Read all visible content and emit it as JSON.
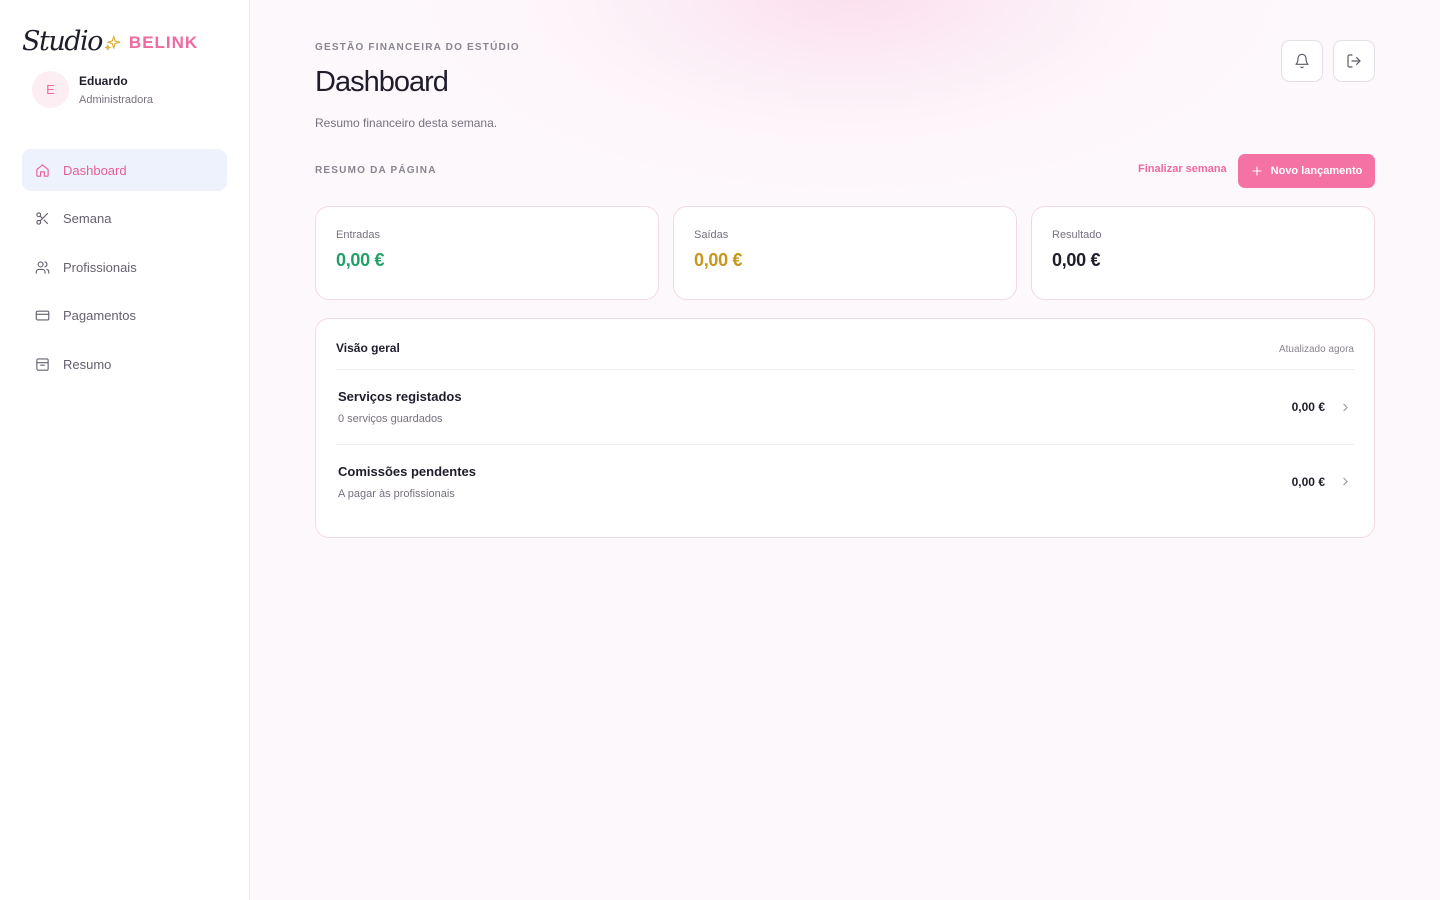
{
  "brand": {
    "studio": "Studio",
    "belink": "BELINK",
    "accent": "#ee6aa0",
    "sparkle_color": "#e0b13a"
  },
  "user": {
    "initial": "E",
    "name": "Eduardo",
    "role": "Administradora"
  },
  "nav": [
    {
      "label": "Dashboard",
      "icon": "home-icon",
      "active": true
    },
    {
      "label": "Semana",
      "icon": "scissors-icon"
    },
    {
      "label": "Profissionais",
      "icon": "users-icon"
    },
    {
      "label": "Pagamentos",
      "icon": "credit-card-icon"
    },
    {
      "label": "Resumo",
      "icon": "archive-icon"
    }
  ],
  "header": {
    "eyebrow": "GESTÃO FINANCEIRA DO ESTÚDIO",
    "title": "Dashboard",
    "subtitle": "Resumo financeiro desta semana."
  },
  "actions": {
    "section_label": "RESUMO DA PÁGINA",
    "finalize": "Finalizar semana",
    "new_entry": "Novo lançamento"
  },
  "stats": [
    {
      "label": "Entradas",
      "value": "0,00 €",
      "color": "#21a06a"
    },
    {
      "label": "Saídas",
      "value": "0,00 €",
      "color": "#c8961a"
    },
    {
      "label": "Resultado",
      "value": "0,00 €",
      "color": "#1f1d2b"
    }
  ],
  "overview": {
    "title": "Visão geral",
    "updated": "Atualizado agora",
    "rows": [
      {
        "title": "Serviços registados",
        "subtitle": "0 serviços guardados",
        "value": "0,00 €"
      },
      {
        "title": "Comissões pendentes",
        "subtitle": "A pagar às profissionais",
        "value": "0,00 €"
      }
    ]
  }
}
